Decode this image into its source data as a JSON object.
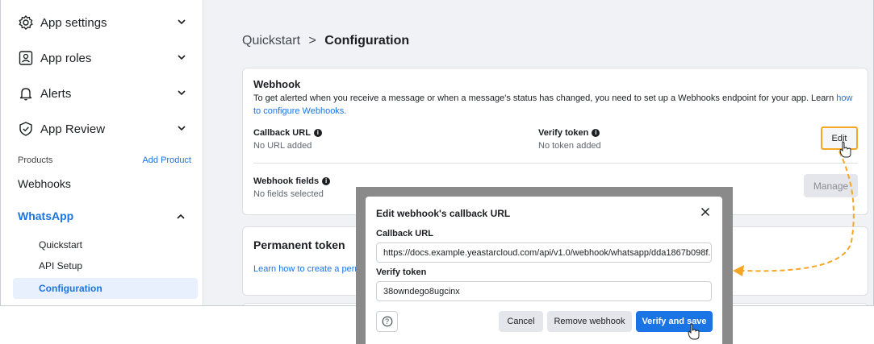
{
  "sidebar": {
    "items": [
      {
        "label": "App settings",
        "icon": "gear-icon"
      },
      {
        "label": "App roles",
        "icon": "id-badge-icon"
      },
      {
        "label": "Alerts",
        "icon": "bell-icon"
      },
      {
        "label": "App Review",
        "icon": "shield-check-icon"
      }
    ],
    "products_label": "Products",
    "add_product_label": "Add Product",
    "webhooks_label": "Webhooks",
    "whatsapp_label": "WhatsApp",
    "whatsapp_sub": {
      "quickstart": "Quickstart",
      "api_setup": "API Setup",
      "configuration": "Configuration"
    }
  },
  "breadcrumb": {
    "parent": "Quickstart",
    "separator": ">",
    "current": "Configuration"
  },
  "webhook_card": {
    "title": "Webhook",
    "description": "To get alerted when you receive a message or when a message's status has changed, you need to set up a Webhooks endpoint for your app. Learn",
    "link_text": "how to configure Webhooks.",
    "callback_url_label": "Callback URL",
    "callback_url_value": "No URL added",
    "verify_token_label": "Verify token",
    "verify_token_value": "No token added",
    "edit_label": "Edit",
    "fields_label": "Webhook fields",
    "fields_value": "No fields selected",
    "manage_label": "Manage"
  },
  "token_card": {
    "title": "Permanent token",
    "link_text": "Learn how to create a perma"
  },
  "modal": {
    "title": "Edit webhook's callback URL",
    "callback_url_label": "Callback URL",
    "callback_url_value": "https://docs.example.yeastarcloud.com/api/v1.0/webhook/whatsapp/dda1867b098f...",
    "verify_token_label": "Verify token",
    "verify_token_value": "38owndego8ugcinx",
    "help_label": "?",
    "cancel_label": "Cancel",
    "remove_label": "Remove webhook",
    "save_label": "Verify and save"
  },
  "colors": {
    "accent": "#1b74e4",
    "highlight": "#f5a623",
    "overlay": "#8a8a8a"
  }
}
